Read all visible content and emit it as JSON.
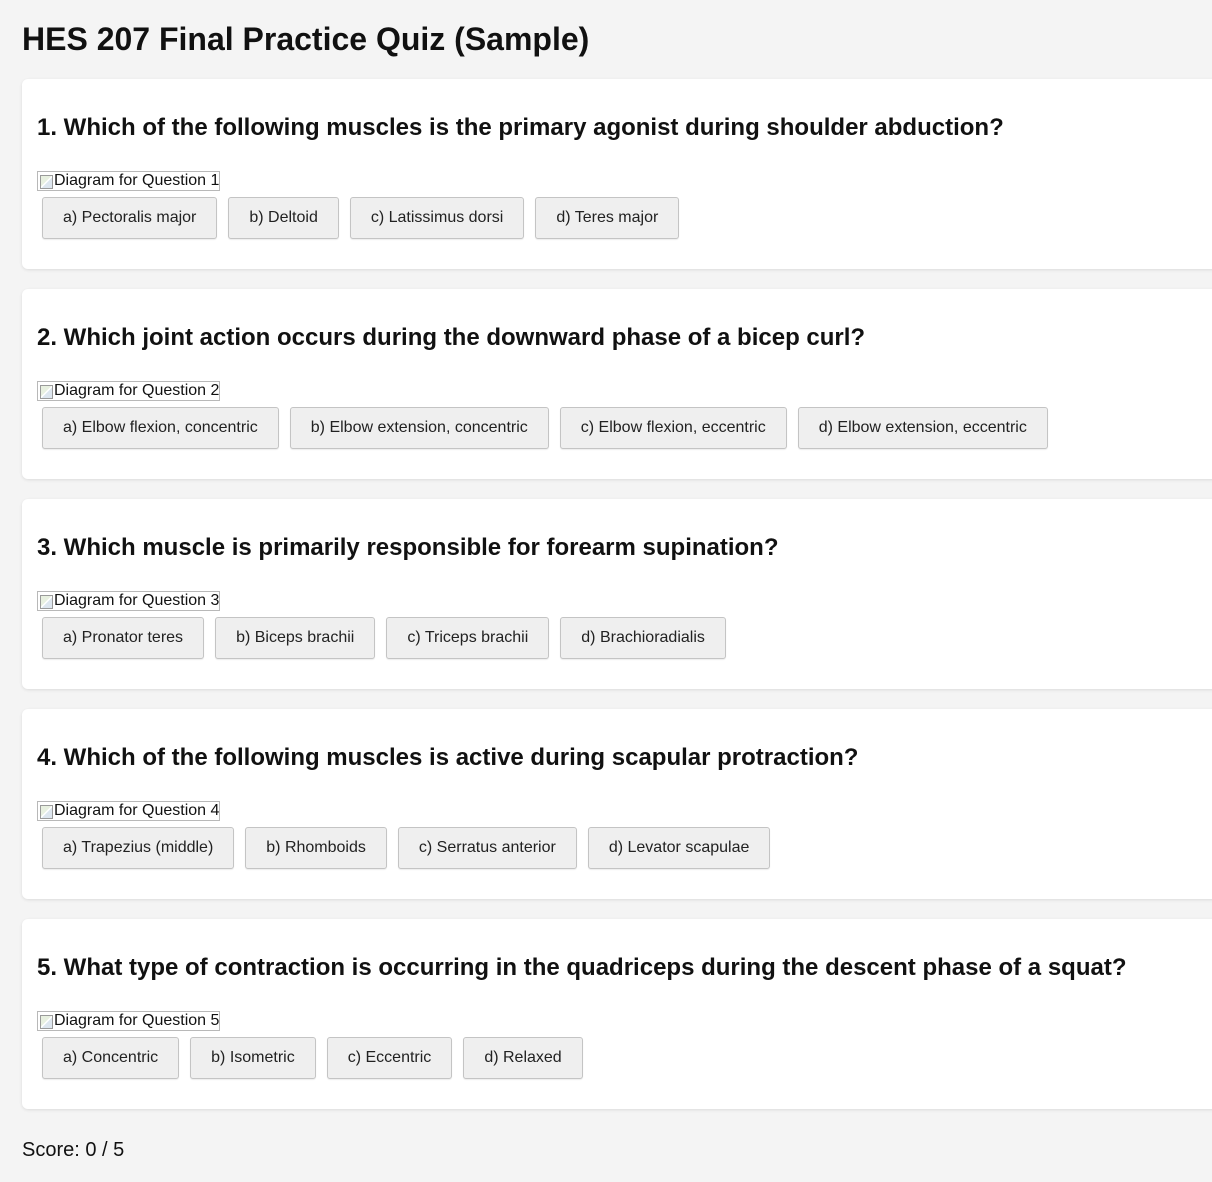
{
  "page": {
    "title": "HES 207 Final Practice Quiz (Sample)"
  },
  "questions": [
    {
      "text": "1. Which of the following muscles is the primary agonist during shoulder abduction?",
      "diagram_alt": "Diagram for Question 1",
      "options": [
        "a) Pectoralis major",
        "b) Deltoid",
        "c) Latissimus dorsi",
        "d) Teres major"
      ]
    },
    {
      "text": "2. Which joint action occurs during the downward phase of a bicep curl?",
      "diagram_alt": "Diagram for Question 2",
      "options": [
        "a) Elbow flexion, concentric",
        "b) Elbow extension, concentric",
        "c) Elbow flexion, eccentric",
        "d) Elbow extension, eccentric"
      ]
    },
    {
      "text": "3. Which muscle is primarily responsible for forearm supination?",
      "diagram_alt": "Diagram for Question 3",
      "options": [
        "a) Pronator teres",
        "b) Biceps brachii",
        "c) Triceps brachii",
        "d) Brachioradialis"
      ]
    },
    {
      "text": "4. Which of the following muscles is active during scapular protraction?",
      "diagram_alt": "Diagram for Question 4",
      "options": [
        "a) Trapezius (middle)",
        "b) Rhomboids",
        "c) Serratus anterior",
        "d) Levator scapulae"
      ]
    },
    {
      "text": "5. What type of contraction is occurring in the quadriceps during the descent phase of a squat?",
      "diagram_alt": "Diagram for Question 5",
      "options": [
        "a) Concentric",
        "b) Isometric",
        "c) Eccentric",
        "d) Relaxed"
      ]
    }
  ],
  "score": {
    "label": "Score: 0 / 5"
  }
}
